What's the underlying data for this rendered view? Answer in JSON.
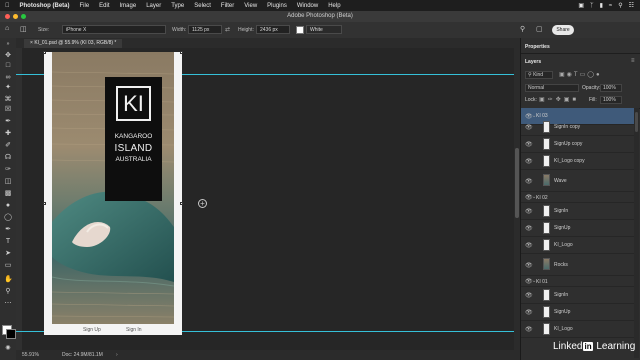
{
  "menubar": {
    "app": "Photoshop (Beta)",
    "items": [
      "File",
      "Edit",
      "Image",
      "Layer",
      "Type",
      "Select",
      "Filter",
      "View",
      "Plugins",
      "Window",
      "Help"
    ]
  },
  "window": {
    "title": "Adobe Photoshop (Beta)"
  },
  "options": {
    "size_label": "Size:",
    "size_value": "iPhone X",
    "width_label": "Width:",
    "width_value": "1125 px",
    "height_label": "Height:",
    "height_value": "2436 px",
    "color_value": "White",
    "share": "Share"
  },
  "document": {
    "tab": "KI_01.psd @ 55.9% (KI 03, RGB/8) *",
    "zoom": "55.91%",
    "doc_info": "Doc: 24.9M/81.1M"
  },
  "artboard": {
    "logo_big": "KI",
    "logo_line1": "KANGAROO",
    "logo_line2": "ISLAND",
    "logo_line3": "AUSTRALIA",
    "signup": "Sign Up",
    "signin": "Sign In"
  },
  "panel": {
    "properties_tab": "Properties",
    "layers_tab": "Layers",
    "kind": "Kind",
    "blend": "Normal",
    "opacity_label": "Opacity:",
    "opacity_value": "100%",
    "lock_label": "Lock:",
    "fill_label": "Fill:",
    "fill_value": "100%",
    "layers": [
      {
        "name": "KI 03",
        "group": true,
        "selected": true
      },
      {
        "name": "SignIn copy",
        "group": false
      },
      {
        "name": "SignUp copy",
        "group": false
      },
      {
        "name": "KI_Logo copy",
        "group": false
      },
      {
        "name": "Wave",
        "group": false,
        "photo": true
      },
      {
        "name": "KI 02",
        "group": true
      },
      {
        "name": "SignIn",
        "group": false
      },
      {
        "name": "SignUp",
        "group": false
      },
      {
        "name": "KI_Logo",
        "group": false
      },
      {
        "name": "Rocks",
        "group": false,
        "photo": true
      },
      {
        "name": "KI 01",
        "group": true
      },
      {
        "name": "SignIn",
        "group": false
      },
      {
        "name": "SignUp",
        "group": false
      },
      {
        "name": "KI_Logo",
        "group": false
      }
    ]
  },
  "watermark": {
    "pre": "Linked",
    "in": "in",
    "post": "Learning"
  }
}
